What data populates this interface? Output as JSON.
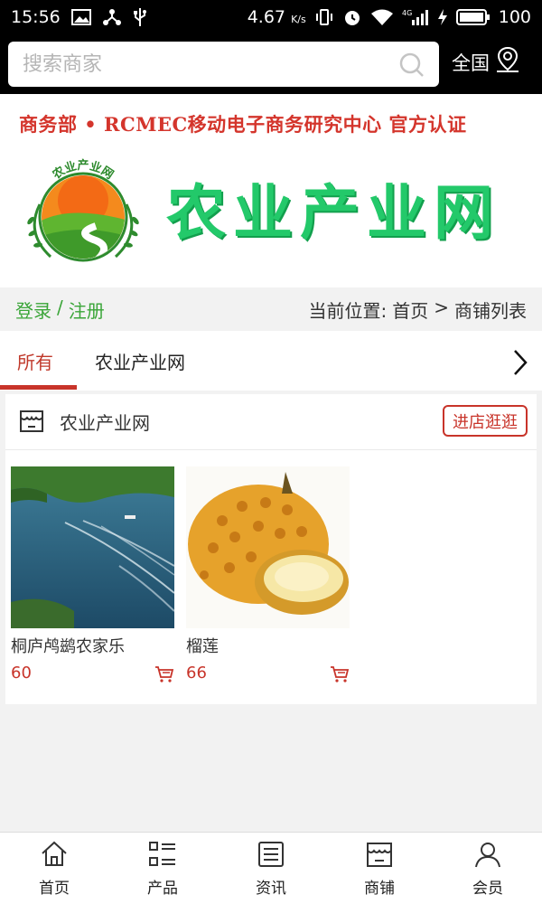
{
  "status_bar": {
    "time": "15:56",
    "speed": "4.67",
    "speed_unit": "K/s",
    "network_badge": "4G",
    "battery": "100"
  },
  "search": {
    "placeholder": "搜索商家",
    "region_label": "全国"
  },
  "banner": {
    "certification": "商务部 • RCMEC移动电子商务研究中心 官方认证",
    "logo_text": "农业产业网",
    "site_name": "农业产业网"
  },
  "breadcrumb_bar": {
    "login": "登录",
    "separator": "/",
    "register": "注册",
    "location_prefix": "当前位置:",
    "home": "首页",
    "arrow": ">",
    "current": "商铺列表"
  },
  "tabs": [
    {
      "label": "所有",
      "active": true
    },
    {
      "label": "农业产业网",
      "active": false
    }
  ],
  "shop": {
    "name": "农业产业网",
    "visit_label": "进店逛逛",
    "products": [
      {
        "name": "桐庐鸬鹚农家乐",
        "price": "60",
        "image": "lake-boats-image"
      },
      {
        "name": "榴莲",
        "price": "66",
        "image": "durian-image"
      }
    ]
  },
  "bottom_nav": [
    {
      "label": "首页",
      "icon": "home-icon"
    },
    {
      "label": "产品",
      "icon": "product-grid-icon"
    },
    {
      "label": "资讯",
      "icon": "news-icon"
    },
    {
      "label": "商铺",
      "icon": "shop-icon"
    },
    {
      "label": "会员",
      "icon": "member-icon"
    }
  ],
  "colors": {
    "brand_red": "#c8342a",
    "brand_green": "#23c96a",
    "link_green": "#3aa538"
  }
}
